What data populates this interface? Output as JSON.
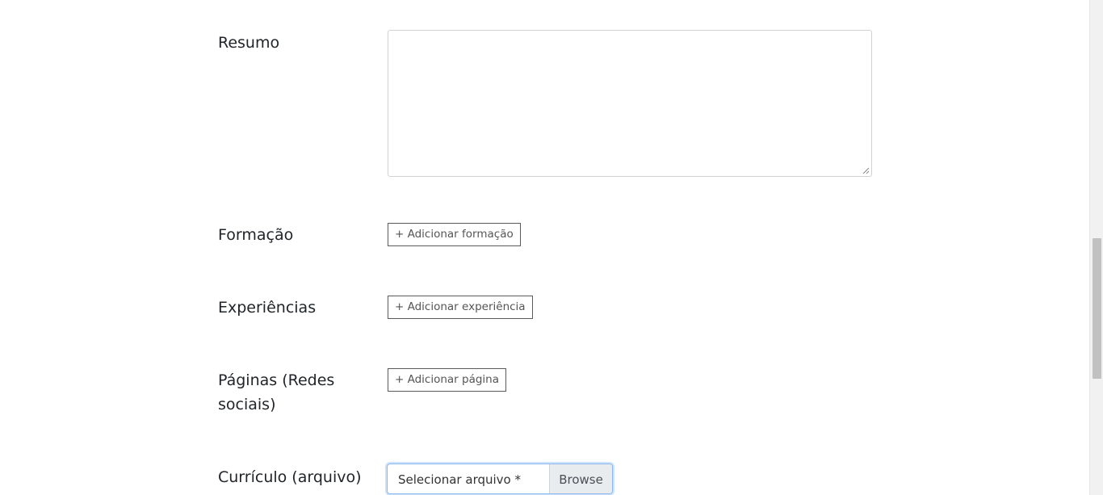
{
  "form": {
    "resumo": {
      "label": "Resumo",
      "value": ""
    },
    "formacao": {
      "label": "Formação",
      "button_label": "+ Adicionar formação"
    },
    "experiencias": {
      "label": "Experiências",
      "button_label": "+ Adicionar experiência"
    },
    "paginas": {
      "label": "Páginas (Redes sociais)",
      "button_label": "+ Adicionar página"
    },
    "curriculo": {
      "label": "Currículo (arquivo)",
      "file_placeholder": "Selecionar arquivo *",
      "browse_label": "Browse"
    }
  },
  "colors": {
    "focus_border": "#8cb8ec",
    "button_border": "#5a5a5a",
    "browse_bg": "#e9ecef"
  }
}
